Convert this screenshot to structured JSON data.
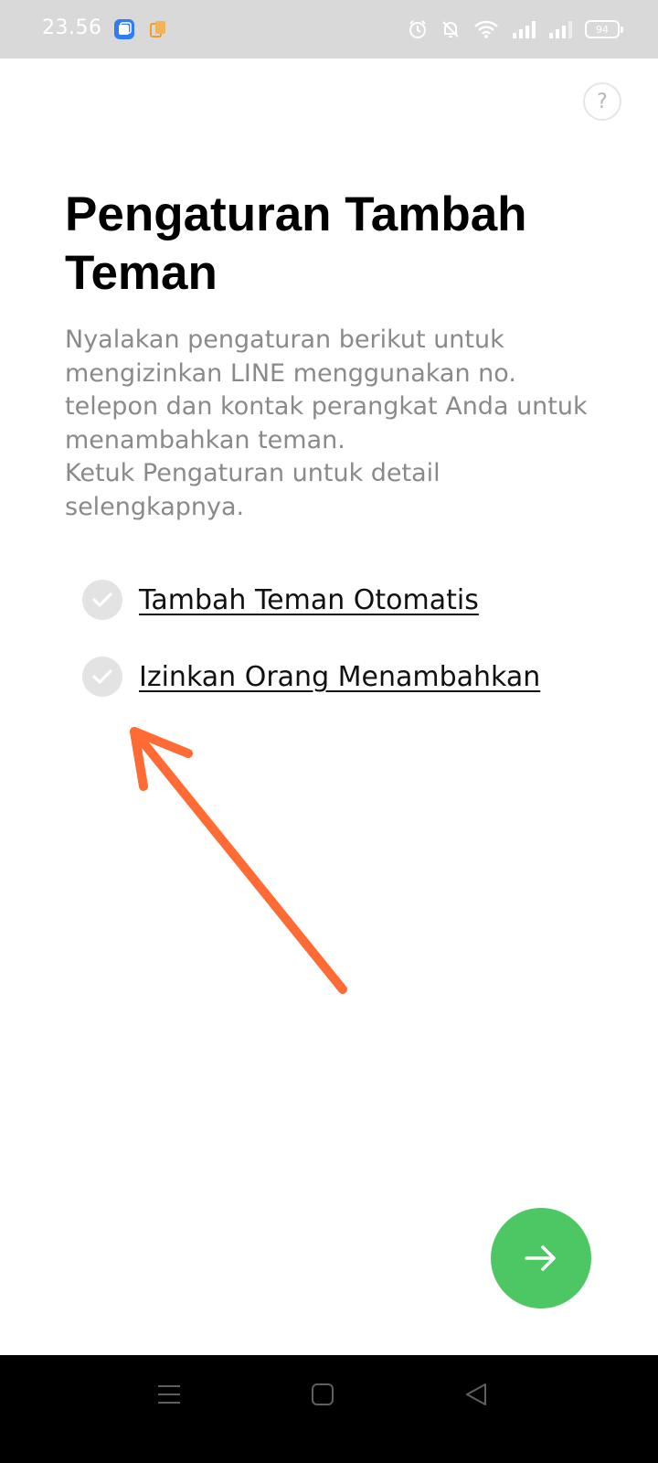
{
  "status_bar": {
    "time": "23.56",
    "battery_level": "94",
    "icons": [
      "app-notification-icon",
      "copy-notification-icon",
      "alarm-icon",
      "mute-icon",
      "wifi-icon",
      "signal-icon",
      "signal-icon-2",
      "battery-icon"
    ]
  },
  "help": {
    "label": "?"
  },
  "page": {
    "title": "Pengaturan Tambah Teman",
    "description": "Nyalakan pengaturan berikut untuk\nmengizinkan LINE menggunakan no.\ntelepon dan kontak perangkat Anda untuk\nmenambahkan teman.\nKetuk Pengaturan untuk detail\nselengkapnya."
  },
  "settings": [
    {
      "label": "Tambah Teman Otomatis",
      "checked": false
    },
    {
      "label": "Izinkan Orang Menambahkan",
      "checked": false
    }
  ],
  "next_button": {
    "icon": "arrow-right-icon"
  },
  "colors": {
    "accent": "#4cc764",
    "annotation": "#ff6a35",
    "status_bar_bg": "#d9d9d9",
    "description_text": "#8a8a8a"
  },
  "navigation_bar": {
    "icons": [
      "menu-icon",
      "home-icon",
      "back-icon"
    ]
  }
}
